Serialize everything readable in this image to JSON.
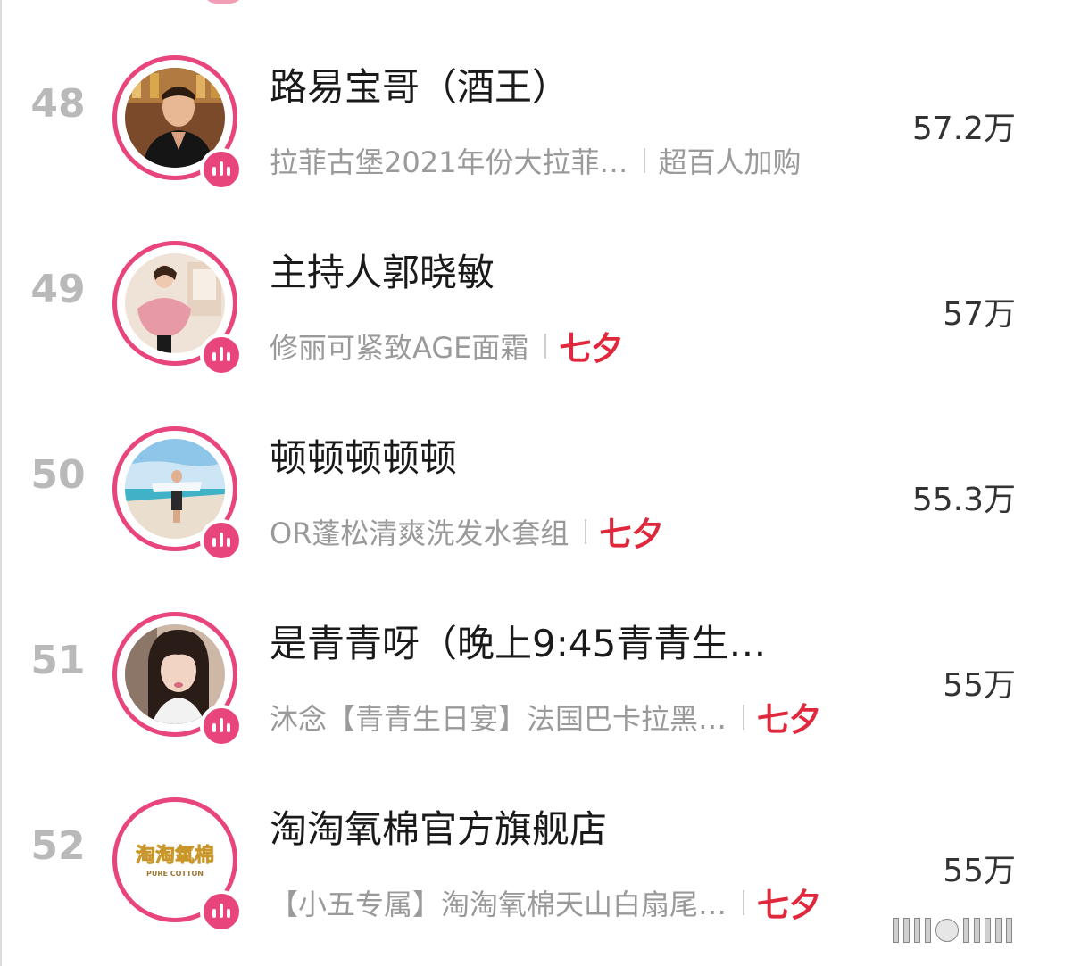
{
  "ranking": {
    "items": [
      {
        "rank": "48",
        "name": "路易宝哥（酒王）",
        "product": "拉菲古堡2021年份大拉菲…",
        "tag": "超百人加购",
        "tag_style": "plain",
        "count": "57.2万",
        "avatar": "man-in-suit-photo"
      },
      {
        "rank": "49",
        "name": "主持人郭晓敏",
        "product": "修丽可紧致AGE面霜",
        "tag": "七夕",
        "tag_style": "highlight",
        "count": "57万",
        "avatar": "woman-pink-dress-photo"
      },
      {
        "rank": "50",
        "name": "顿顿顿顿顿",
        "product": "OR蓬松清爽洗发水套组",
        "tag": "七夕",
        "tag_style": "highlight",
        "count": "55.3万",
        "avatar": "beach-photo"
      },
      {
        "rank": "51",
        "name": "是青青呀（晚上9:45青青生…",
        "product": "沐念【青青生日宴】法国巴卡拉黑…",
        "tag": "七夕",
        "tag_style": "highlight",
        "count": "55万",
        "avatar": "woman-portrait-photo"
      },
      {
        "rank": "52",
        "name": "淘淘氧棉官方旗舰店",
        "product": "【小五专属】淘淘氧棉天山白扇尾…",
        "tag": "七夕",
        "tag_style": "highlight",
        "count": "55万",
        "avatar": "brand-logo",
        "logo_text": "淘淘氧棉",
        "logo_sub": "PURE COTTON"
      }
    ]
  },
  "colors": {
    "accent": "#e8457d",
    "tag": "#e0283c",
    "rank": "#b9b9b9",
    "muted": "#9a9a9a"
  }
}
